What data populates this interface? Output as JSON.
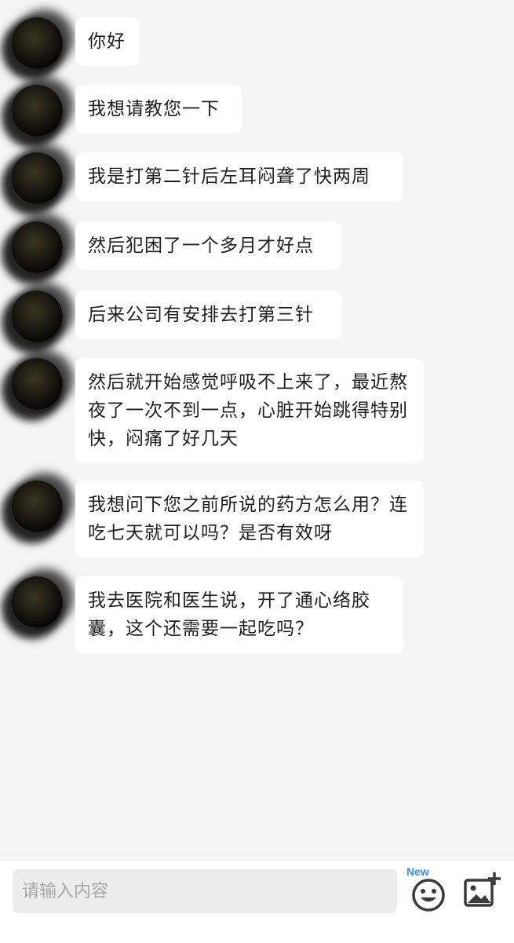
{
  "messages": [
    {
      "text": "你好"
    },
    {
      "text": "我想请教您一下"
    },
    {
      "text": "我是打第二针后左耳闷聋了快两周"
    },
    {
      "text": "然后犯困了一个多月才好点"
    },
    {
      "text": "后来公司有安排去打第三针"
    },
    {
      "text": "然后就开始感觉呼吸不上来了，最近熬夜了一次不到一点，心脏开始跳得特别快，闷痛了好几天"
    },
    {
      "text": "我想问下您之前所说的药方怎么用？连吃七天就可以吗？是否有效呀"
    },
    {
      "text": "我去医院和医生说，开了通心络胶囊，这个还需要一起吃吗？"
    }
  ],
  "input": {
    "placeholder": "请输入内容",
    "value": ""
  },
  "toolbar": {
    "emoji_badge": "New",
    "emoji_icon": "smiley-face-icon",
    "image_icon": "add-image-icon"
  },
  "colors": {
    "background": "#f5f5f5",
    "bubble": "#ffffff",
    "badge": "#3a8ee6"
  }
}
